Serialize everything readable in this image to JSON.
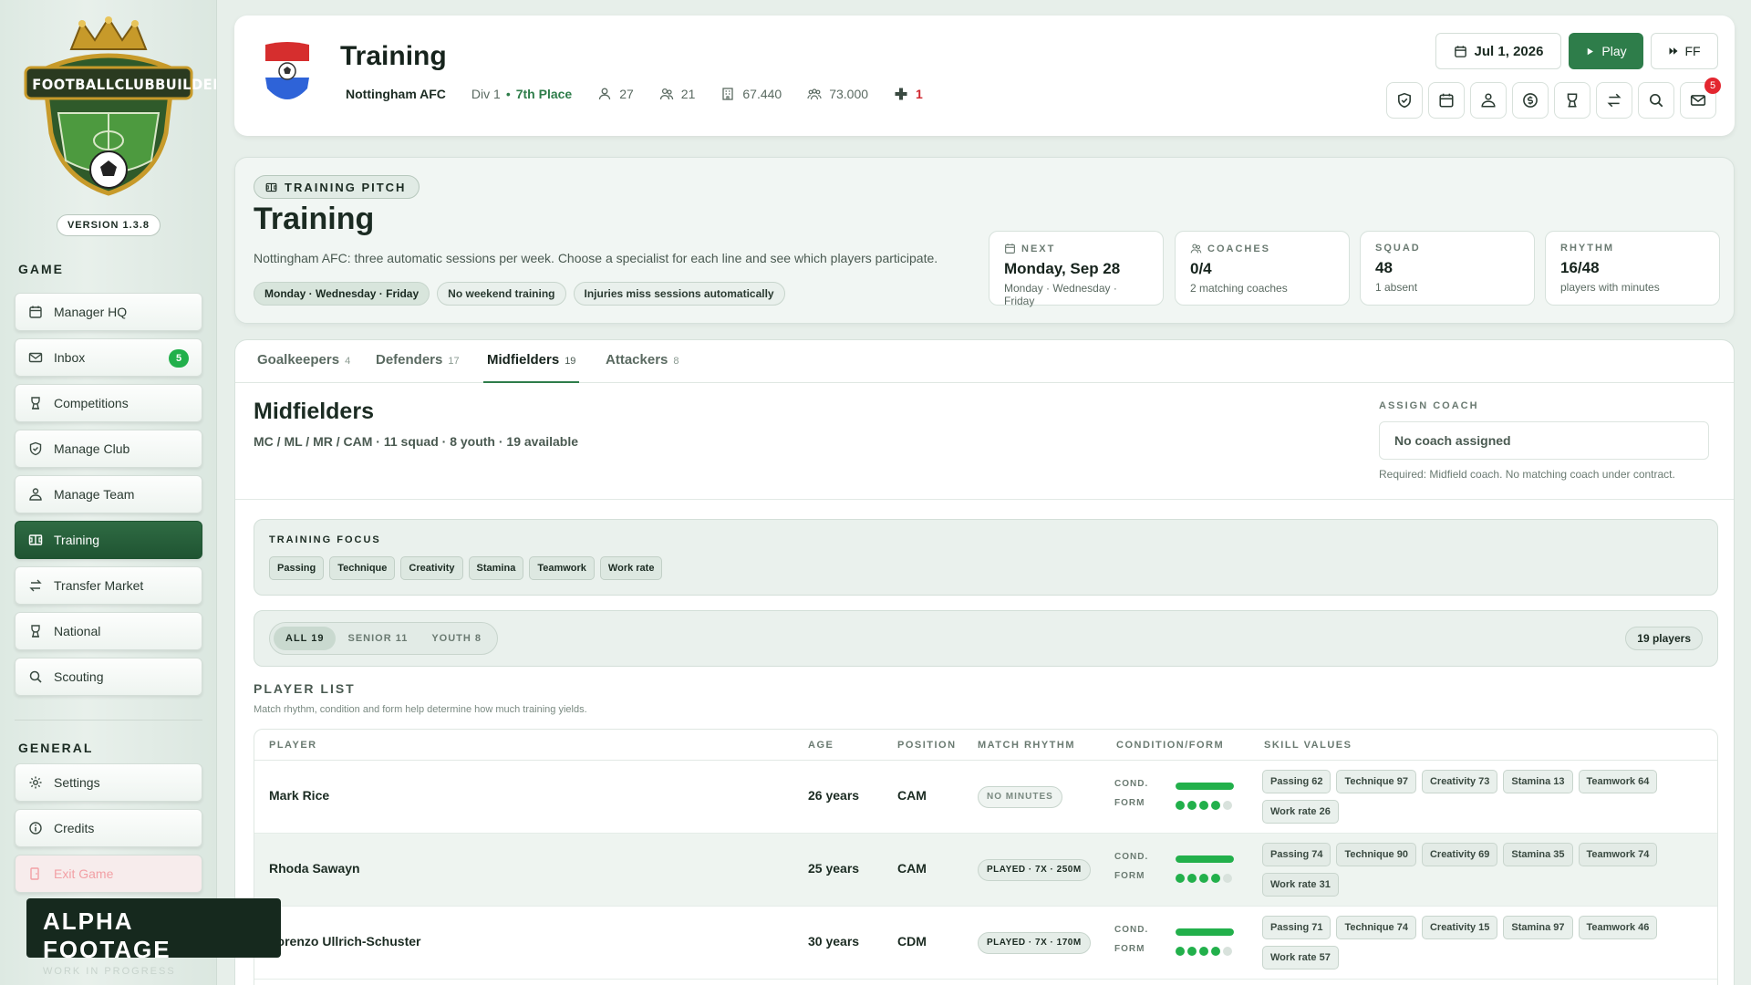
{
  "sidebar": {
    "logo_text": "FOOTBALLCLUBBUILDER",
    "version": "VERSION 1.3.8",
    "game_heading": "GAME",
    "game_items": [
      {
        "label": "Manager HQ",
        "icon": "calendar-icon"
      },
      {
        "label": "Inbox",
        "icon": "mail-icon",
        "badge": "5"
      },
      {
        "label": "Competitions",
        "icon": "trophy-icon"
      },
      {
        "label": "Manage Club",
        "icon": "shield-icon"
      },
      {
        "label": "Manage Team",
        "icon": "team-icon"
      },
      {
        "label": "Training",
        "icon": "pitch-icon",
        "active": true
      },
      {
        "label": "Transfer Market",
        "icon": "transfer-icon"
      },
      {
        "label": "National",
        "icon": "trophy-icon"
      },
      {
        "label": "Scouting",
        "icon": "search-icon"
      }
    ],
    "general_heading": "GENERAL",
    "general_items": [
      {
        "label": "Settings",
        "icon": "gear-icon"
      },
      {
        "label": "Credits",
        "icon": "info-icon"
      },
      {
        "label": "Exit Game",
        "icon": "exit-icon"
      }
    ]
  },
  "watermark": {
    "title": "ALPHA FOOTAGE",
    "subtitle": "WORK IN PROGRESS"
  },
  "header": {
    "title": "Training",
    "club": "Nottingham AFC",
    "division": "Div 1",
    "place": "7th Place",
    "stats": [
      {
        "icon": "player-icon",
        "value": "27"
      },
      {
        "icon": "group-icon",
        "value": "21"
      },
      {
        "icon": "building-icon",
        "value": "67.440"
      },
      {
        "icon": "fans-icon",
        "value": "73.000"
      }
    ],
    "injuries": "1",
    "date": "Jul 1, 2026",
    "play_label": "Play",
    "ff_label": "FF",
    "toolbar_icons": [
      "shield-icon",
      "calendar-icon",
      "team-icon",
      "money-icon",
      "trophy-icon",
      "transfer-icon",
      "search-icon",
      "mail-icon"
    ],
    "mail_badge": "5"
  },
  "hero": {
    "tag": "TRAINING PITCH",
    "title": "Training",
    "description": "Nottingham AFC: three automatic sessions per week. Choose a specialist for each line and see which players participate.",
    "chips": [
      "Monday · Wednesday · Friday",
      "No weekend training",
      "Injuries miss sessions automatically"
    ],
    "stats": [
      {
        "label": "NEXT",
        "value": "Monday, Sep 28",
        "sub": "Monday · Wednesday · Friday",
        "icon": "calendar-icon"
      },
      {
        "label": "COACHES",
        "value": "0/4",
        "sub": "2 matching coaches",
        "icon": "group-icon"
      },
      {
        "label": "SQUAD",
        "value": "48",
        "sub": "1 absent"
      },
      {
        "label": "RHYTHM",
        "value": "16/48",
        "sub": "players with minutes"
      }
    ]
  },
  "tabs": [
    {
      "label": "Goalkeepers",
      "count": "4"
    },
    {
      "label": "Defenders",
      "count": "17"
    },
    {
      "label": "Midfielders",
      "count": "19",
      "active": true
    },
    {
      "label": "Attackers",
      "count": "8"
    }
  ],
  "section": {
    "title": "Midfielders",
    "subtitle": "MC / ML / MR / CAM · 11 squad · 8 youth · 19 available",
    "assign_label": "ASSIGN COACH",
    "assign_value": "No coach assigned",
    "assign_note": "Required: Midfield coach. No matching coach under contract."
  },
  "focus": {
    "label": "TRAINING FOCUS",
    "items": [
      "Passing",
      "Technique",
      "Creativity",
      "Stamina",
      "Teamwork",
      "Work rate"
    ]
  },
  "filter": {
    "options": [
      "ALL 19",
      "SENIOR 11",
      "YOUTH 8"
    ],
    "active": 0,
    "count": "19 players"
  },
  "player_list": {
    "title": "PLAYER LIST",
    "subtitle": "Match rhythm, condition and form help determine how much training yields.",
    "columns": [
      "PLAYER",
      "AGE",
      "POSITION",
      "MATCH RHYTHM",
      "CONDITION/FORM",
      "SKILL VALUES"
    ],
    "cond_label": "COND.",
    "form_label": "FORM",
    "rows": [
      {
        "name": "Mark Rice",
        "age": "26 years",
        "position": "CAM",
        "rhythm": "NO MINUTES",
        "condition": 1.0,
        "form": 4,
        "skills": [
          "Passing 62",
          "Technique 97",
          "Creativity 73",
          "Stamina 13",
          "Teamwork 64",
          "Work rate 26"
        ]
      },
      {
        "name": "Rhoda Sawayn",
        "age": "25 years",
        "position": "CAM",
        "rhythm": "PLAYED · 7X · 250M",
        "condition": 1.0,
        "form": 4,
        "skills": [
          "Passing 74",
          "Technique 90",
          "Creativity 69",
          "Stamina 35",
          "Teamwork 74",
          "Work rate 31"
        ]
      },
      {
        "name": "Lorenzo Ullrich-Schuster",
        "age": "30 years",
        "position": "CDM",
        "rhythm": "PLAYED · 7X · 170M",
        "condition": 1.0,
        "form": 4,
        "skills": [
          "Passing 71",
          "Technique 74",
          "Creativity 15",
          "Stamina 97",
          "Teamwork 46",
          "Work rate 57"
        ]
      }
    ]
  },
  "colors": {
    "accent": "#2e7d4a",
    "active_nav": "#1f5432",
    "bar": "#22b04b",
    "badge_red": "#e3262f"
  }
}
